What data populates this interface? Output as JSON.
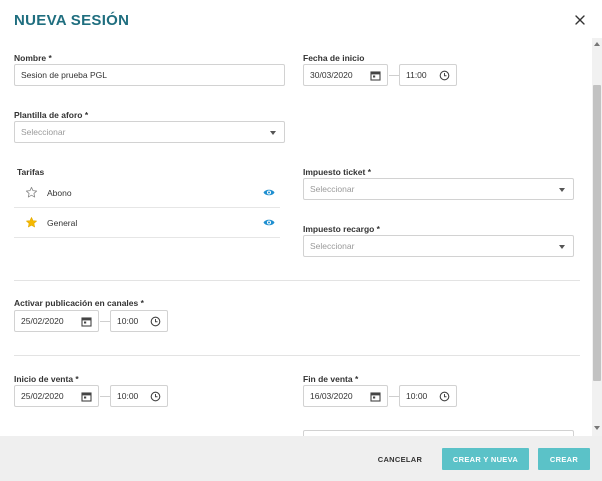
{
  "dialog": {
    "title": "NUEVA SESIÓN"
  },
  "nombre": {
    "label": "Nombre *",
    "value": "Sesion de prueba PGL"
  },
  "fecha_inicio": {
    "label": "Fecha de inicio",
    "date": "30/03/2020",
    "time": "11:00"
  },
  "plantilla": {
    "label": "Plantilla de aforo *",
    "placeholder": "Seleccionar"
  },
  "tarifas": {
    "label": "Tarifas",
    "items": [
      {
        "name": "Abono",
        "favorite": false
      },
      {
        "name": "General",
        "favorite": true
      }
    ]
  },
  "impuesto_ticket": {
    "label": "Impuesto ticket *",
    "placeholder": "Seleccionar"
  },
  "impuesto_recargo": {
    "label": "Impuesto recargo *",
    "placeholder": "Seleccionar"
  },
  "publicacion": {
    "label": "Activar publicación en canales *",
    "date": "25/02/2020",
    "time": "10:00"
  },
  "inicio_venta": {
    "label": "Inicio de venta *",
    "date": "25/02/2020",
    "time": "10:00"
  },
  "fin_venta": {
    "label": "Fin de venta *",
    "date": "16/03/2020",
    "time": "10:00"
  },
  "footer": {
    "cancel_label": "CANCELAR",
    "create_new_label": "CREAR Y NUEVA",
    "create_label": "CREAR"
  },
  "colors": {
    "title": "#1f6e7f",
    "accent": "#5bc2c8",
    "eye": "#1f8fd0",
    "star": "#f5b800"
  },
  "icons": [
    "close-icon",
    "calendar-icon",
    "clock-icon",
    "chevron-down-icon",
    "star-outline-icon",
    "star-filled-icon",
    "eye-icon"
  ]
}
